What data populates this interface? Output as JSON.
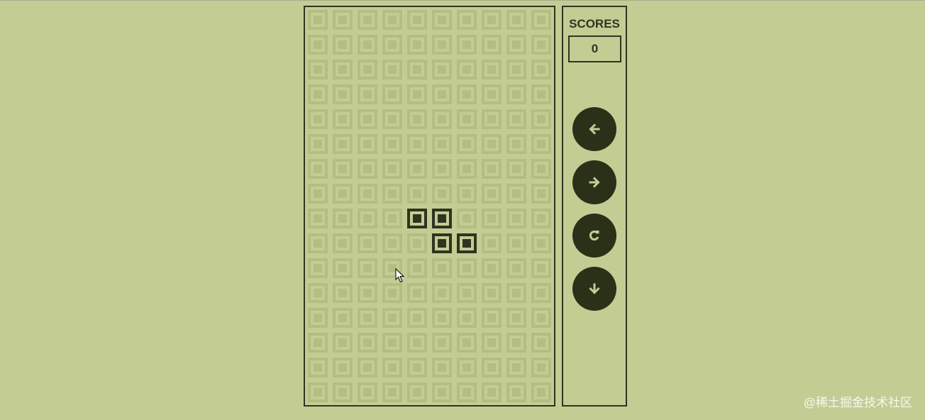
{
  "board": {
    "columns": 10,
    "rows": 16,
    "active_cells": [
      [
        8,
        4
      ],
      [
        8,
        5
      ],
      [
        9,
        5
      ],
      [
        9,
        6
      ]
    ]
  },
  "score": {
    "label": "SCORES",
    "value": "0"
  },
  "controls": [
    {
      "name": "move-left-button",
      "icon": "arrow-left-icon"
    },
    {
      "name": "move-right-button",
      "icon": "arrow-right-icon"
    },
    {
      "name": "rotate-button",
      "icon": "rotate-icon"
    },
    {
      "name": "drop-button",
      "icon": "arrow-down-icon"
    }
  ],
  "watermark": "@稀土掘金技术社区",
  "colors": {
    "background": "#c3cd93",
    "inactive_cell": "#b4bd84",
    "active_cell": "#2f3420",
    "button": "#2b3019",
    "button_icon": "#c3cd93"
  }
}
